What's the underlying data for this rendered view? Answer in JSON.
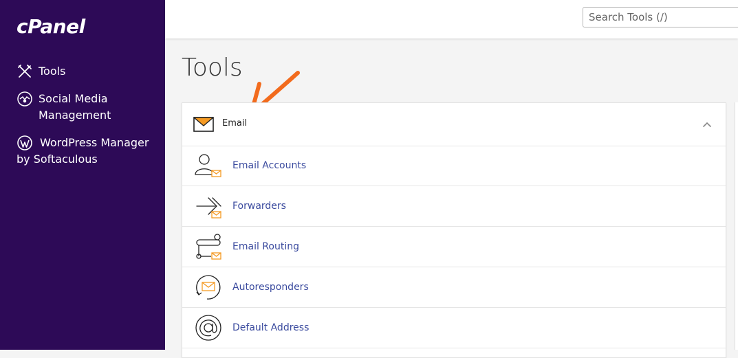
{
  "sidebar": {
    "logo": "cPanel",
    "items": [
      {
        "label": "Tools",
        "icon": "tools-icon"
      },
      {
        "label": "Social Media Management",
        "icon": "social-media-icon"
      },
      {
        "label": "WordPress Manager by Softaculous",
        "icon": "wordpress-icon"
      }
    ]
  },
  "search": {
    "placeholder": "Search Tools (/)"
  },
  "page": {
    "title": "Tools"
  },
  "email_panel": {
    "title": "Email",
    "items": [
      {
        "label": "Email Accounts",
        "icon": "email-accounts-icon"
      },
      {
        "label": "Forwarders",
        "icon": "forwarders-icon"
      },
      {
        "label": "Email Routing",
        "icon": "email-routing-icon"
      },
      {
        "label": "Autoresponders",
        "icon": "autoresponders-icon"
      },
      {
        "label": "Default Address",
        "icon": "default-address-icon"
      }
    ]
  },
  "colors": {
    "sidebar_bg": "#2d0a57",
    "link": "#3a4a9e",
    "accent_orange": "#f5a623",
    "annotation": "#f26b1d"
  }
}
